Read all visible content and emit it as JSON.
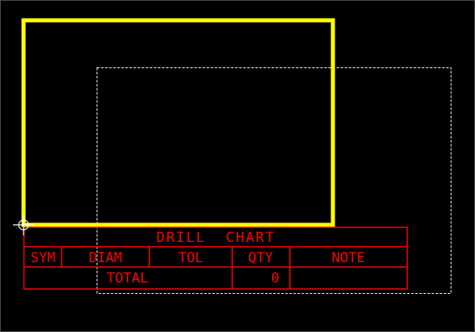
{
  "colors": {
    "background": "#000000",
    "board_outline": "#ffff00",
    "selection_box": "#ffffff",
    "drill_chart": "#ff0000",
    "cursor": "#ffffff"
  },
  "drill_chart": {
    "title": "DRILL  CHART",
    "columns": [
      "SYM",
      "DIAM",
      "TOL",
      "QTY",
      "NOTE"
    ],
    "total_label": "TOTAL",
    "total_qty": "0"
  }
}
